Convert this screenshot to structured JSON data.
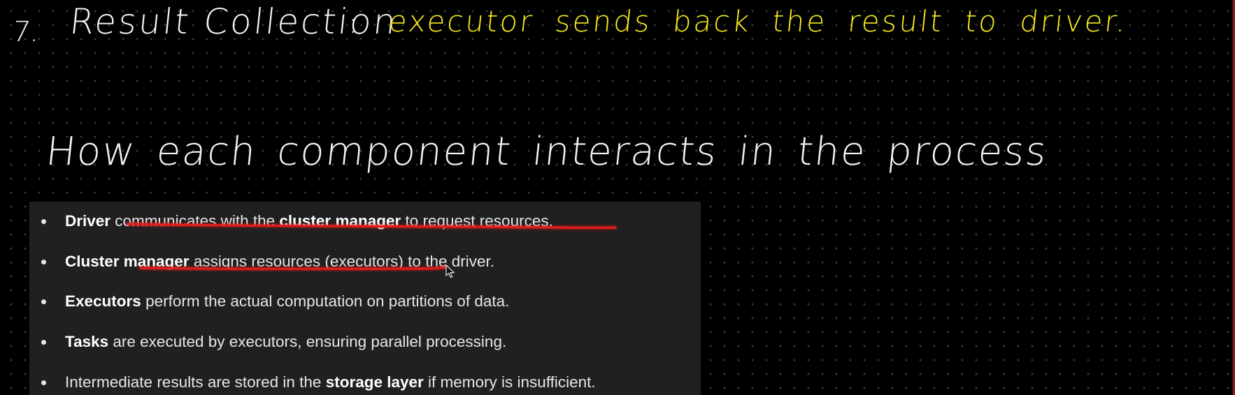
{
  "note": {
    "step_number": "7.",
    "step_title": "Result Collection",
    "separator": ":",
    "step_description": "executor sends back the result to driver.",
    "section_heading": "How each component interacts in the process"
  },
  "bullets": [
    {
      "segments": [
        {
          "text": "Driver",
          "bold": true
        },
        {
          "text": " communicates with the ",
          "bold": false
        },
        {
          "text": "cluster manager",
          "bold": true
        },
        {
          "text": " to request resources.",
          "bold": false
        }
      ]
    },
    {
      "segments": [
        {
          "text": "Cluster manager",
          "bold": true
        },
        {
          "text": " assigns resources (executors) to the driver.",
          "bold": false
        }
      ]
    },
    {
      "segments": [
        {
          "text": "Executors",
          "bold": true
        },
        {
          "text": " perform the actual computation on partitions of data.",
          "bold": false
        }
      ]
    },
    {
      "segments": [
        {
          "text": "Tasks",
          "bold": true
        },
        {
          "text": " are executed by executors, ensuring parallel processing.",
          "bold": false
        }
      ]
    },
    {
      "segments": [
        {
          "text": "Intermediate results are stored in the ",
          "bold": false
        },
        {
          "text": "storage layer",
          "bold": true
        },
        {
          "text": " if memory is insufficient.",
          "bold": false
        }
      ]
    }
  ],
  "colors": {
    "background": "#000000",
    "grid_dot": "#3a3a3a",
    "handwriting_white": "#f4f4f4",
    "handwriting_yellow": "#f6ea1c",
    "panel_background": "#202020",
    "underline_stroke": "#e41b1b"
  },
  "icons": {
    "pointer": "mouse-cursor-icon",
    "bullet": "bullet-dot"
  }
}
